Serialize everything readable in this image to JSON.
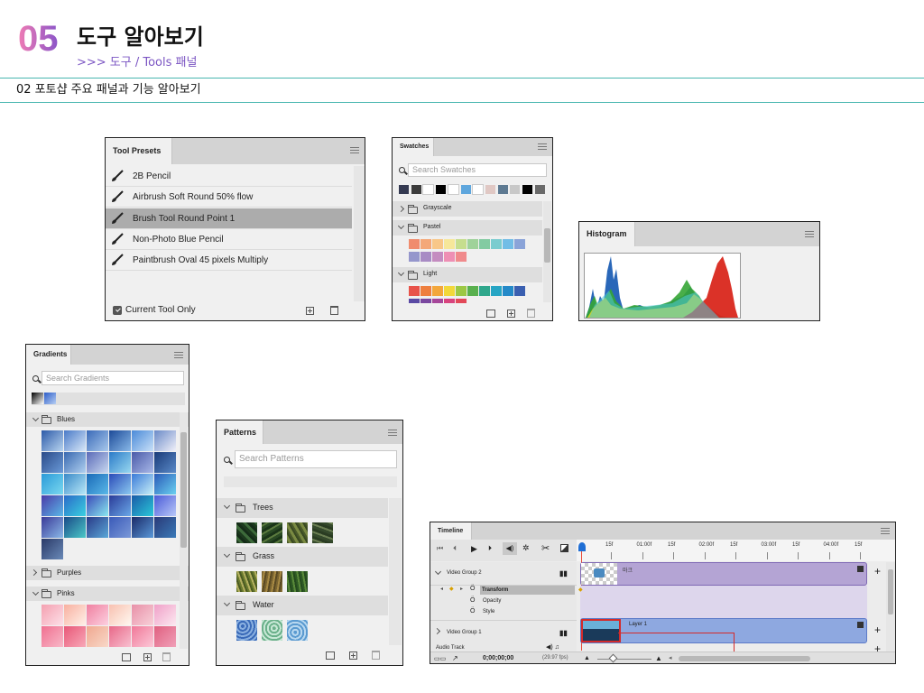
{
  "header": {
    "number": "05",
    "title": "도구 알아보기",
    "subtitle": ">>> 도구 / Tools 패널",
    "section": "02 포토샵 주요 패널과 기능 알아보기"
  },
  "colors": {
    "accent_pink": "#f07cb4",
    "accent_purple": "#8a55c9",
    "rule_teal": "#48b6b0"
  },
  "tool_presets": {
    "tab": "Tool Presets",
    "items": [
      "2B Pencil",
      "Airbrush Soft Round 50% flow",
      "Brush Tool Round Point 1",
      "Non-Photo Blue Pencil",
      "Paintbrush Oval 45 pixels Multiply"
    ],
    "selected_index": 2,
    "current_tool_only": "Current Tool Only"
  },
  "swatches": {
    "tab": "Swatches",
    "search_placeholder": "Search Swatches",
    "recent": [
      "#353a52",
      "#3c3c3c",
      "#ffffff",
      "#000000",
      "#ffffff",
      "#5ea6dd",
      "#ffffff",
      "#e0c8c4",
      "#5e7a92",
      "#c8c8c8",
      "#000000",
      "#6a6a6a"
    ],
    "groups": [
      {
        "name": "Grayscale",
        "expanded": false,
        "colors": []
      },
      {
        "name": "Pastel",
        "expanded": true,
        "colors": [
          "#f08c6e",
          "#f4a878",
          "#f8c788",
          "#f6e79a",
          "#c6de8e",
          "#9fd29a",
          "#83cba2",
          "#7bcccf",
          "#72bde6",
          "#8aa3d8",
          "#9596cc",
          "#a88bc4",
          "#c48cc0",
          "#ee8fb4",
          "#f08a8c"
        ]
      },
      {
        "name": "Light",
        "expanded": true,
        "colors": [
          "#e8534a",
          "#ee7f3f",
          "#f3a73c",
          "#f2d83a",
          "#9cc844",
          "#59b04e",
          "#2fa78c",
          "#26a5c4",
          "#2489c8",
          "#3a5fb0",
          "#5a4aa4",
          "#7a48a0",
          "#a6479a",
          "#d8447e",
          "#e24858"
        ]
      }
    ]
  },
  "histogram": {
    "tab": "Histogram"
  },
  "gradients": {
    "tab": "Gradients",
    "search_placeholder": "Search Gradients",
    "groups": [
      "Blues",
      "Purples",
      "Pinks"
    ]
  },
  "patterns": {
    "tab": "Patterns",
    "search_placeholder": "Search Patterns",
    "groups": [
      "Trees",
      "Grass",
      "Water"
    ]
  },
  "timeline": {
    "tab": "Timeline",
    "ruler": [
      "15f",
      "01:00f",
      "15f",
      "02:00f",
      "15f",
      "03:00f",
      "15f",
      "04:00f",
      "15f"
    ],
    "tracks": {
      "video_group_2": "Video Group 2",
      "transform": "Transform",
      "opacity": "Opacity",
      "style": "Style",
      "video_group_1": "Video Group 1",
      "audio_track": "Audio Track"
    },
    "clip_2_label": "마크",
    "clip_1_label": "Layer 1",
    "timecode": "0;00;00;00",
    "fps": "(29.97 fps)"
  }
}
